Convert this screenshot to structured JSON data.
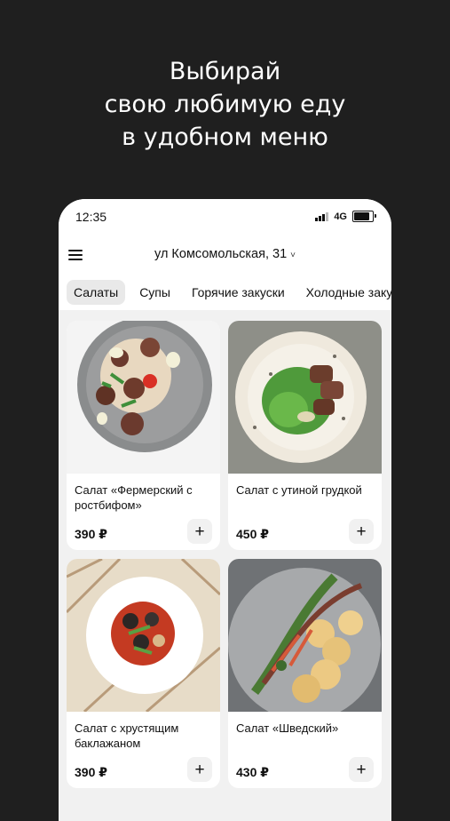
{
  "promo": {
    "line1": "Выбирай",
    "line2": "свою любимую еду",
    "line3": "в удобном меню"
  },
  "status_bar": {
    "time": "12:35",
    "network": "4G",
    "icons": [
      "signal-icon",
      "battery-icon"
    ]
  },
  "header": {
    "menu_icon": "hamburger-icon",
    "address": "ул Комсомольская, 31",
    "address_chevron": "˅"
  },
  "tabs": [
    {
      "label": "Салаты",
      "active": true
    },
    {
      "label": "Супы",
      "active": false
    },
    {
      "label": "Горячие закуски",
      "active": false
    },
    {
      "label": "Холодные закуски",
      "active": false
    }
  ],
  "products": [
    {
      "title": "Салат «Фермерский с ростбифом»",
      "price": "390 ₽",
      "add_label": "+"
    },
    {
      "title": "Салат с утиной грудкой",
      "price": "450 ₽",
      "add_label": "+"
    },
    {
      "title": "Салат с хрустящим баклажаном",
      "price": "390 ₽",
      "add_label": "+"
    },
    {
      "title": "Салат «Шведский»",
      "price": "430 ₽",
      "add_label": "+"
    }
  ],
  "colors": {
    "background": "#1f1f1f",
    "screen": "#f1f1f1",
    "card": "#ffffff",
    "text": "#111111"
  }
}
